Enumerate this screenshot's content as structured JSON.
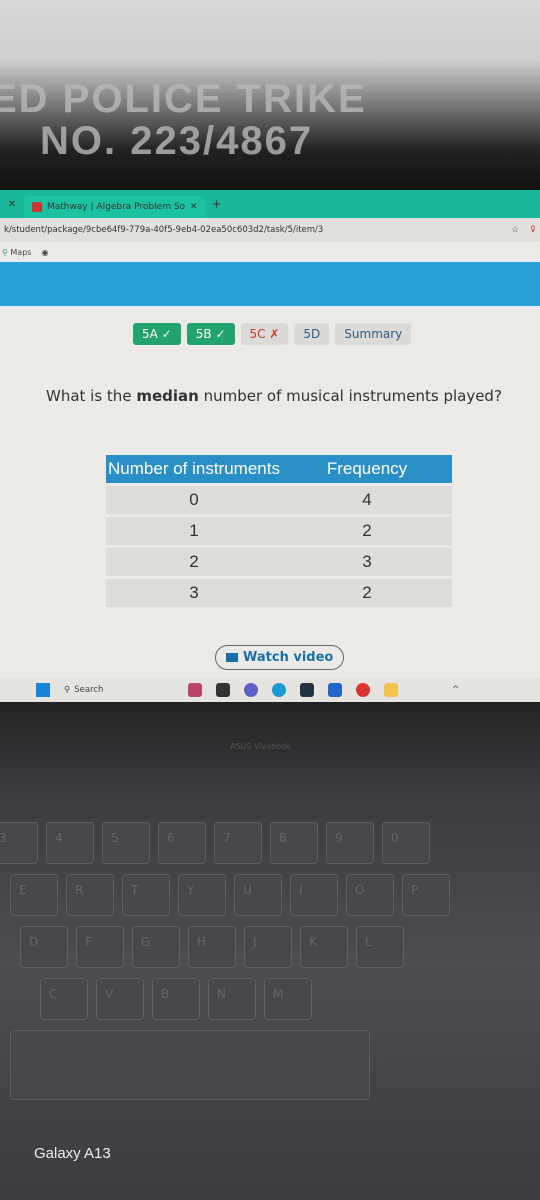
{
  "background": {
    "sticker_line1": "ED POLICE TRIKE",
    "sticker_line2": "NO. 223/4867"
  },
  "browser": {
    "tab_title": "Mathway | Algebra Problem So",
    "address": "k/student/package/9cbe64f9-779a-40f5-9eb4-02ea50c603d2/task/5/item/3",
    "bookmarks": [
      "Maps"
    ]
  },
  "tasks": [
    {
      "label": "5A",
      "status": "✓"
    },
    {
      "label": "5B",
      "status": "✓"
    },
    {
      "label": "5C",
      "status": "✗"
    },
    {
      "label": "5D",
      "status": ""
    },
    {
      "label": "Summary",
      "status": ""
    }
  ],
  "question": {
    "pre": "What is the ",
    "bold": "median",
    "post": " number of musical instruments played?"
  },
  "table": {
    "headers": [
      "Number of instruments",
      "Frequency"
    ],
    "rows": [
      [
        "0",
        "4"
      ],
      [
        "1",
        "2"
      ],
      [
        "2",
        "3"
      ],
      [
        "3",
        "2"
      ]
    ]
  },
  "watch_video": "Watch video",
  "taskbar": {
    "search": "Search"
  },
  "laptop": {
    "brand": "ASUS Vivobook",
    "keys_row1": [
      "3",
      "4",
      "5",
      "6",
      "7",
      "8",
      "9",
      "0"
    ],
    "keys_row2": [
      "E",
      "R",
      "T",
      "Y",
      "U",
      "I",
      "O",
      "P"
    ],
    "keys_row3": [
      "D",
      "F",
      "G",
      "H",
      "J",
      "K",
      "L"
    ],
    "keys_row4": [
      "C",
      "V",
      "B",
      "N",
      "M"
    ]
  },
  "watermark": "Galaxy A13",
  "colors": {
    "accent": "#2b9fd6",
    "done": "#22a36d",
    "wrong": "#c0392b",
    "tabbar": "#19b89a"
  }
}
